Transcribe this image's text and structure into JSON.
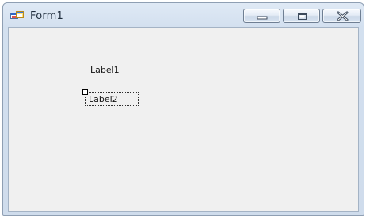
{
  "window": {
    "title": "Form1",
    "icon": "form-icon"
  },
  "title_bar_buttons": {
    "minimize_icon": "minimize-icon",
    "maximize_icon": "maximize-icon",
    "close_icon": "close-icon"
  },
  "form": {
    "background_color": "#f0f0f0",
    "labels": [
      {
        "text": "Label1",
        "selected": false
      },
      {
        "text": "Label2",
        "selected": true
      }
    ]
  }
}
